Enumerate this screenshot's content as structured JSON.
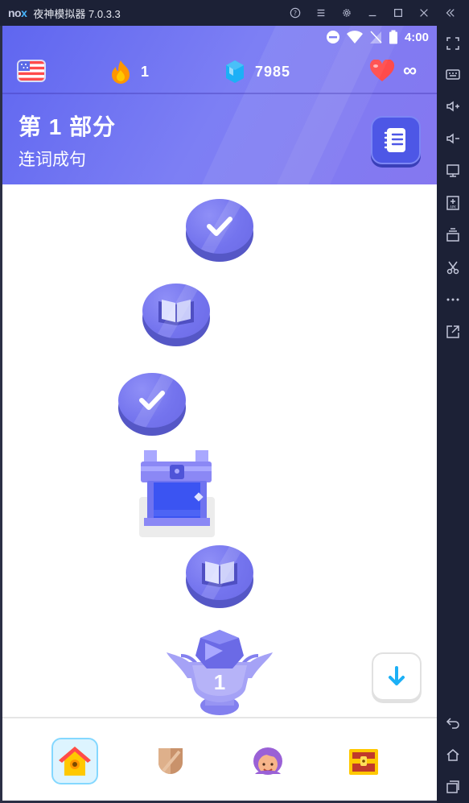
{
  "emulator": {
    "logo_a": "no",
    "logo_b": "x",
    "title": "夜神模拟器 7.0.3.3",
    "controls": [
      "help-icon",
      "menu-icon",
      "settings-icon",
      "minimize-icon",
      "maximize-icon",
      "close-icon",
      "collapse-icon"
    ],
    "sidebar_icons": [
      "fullscreen-icon",
      "keyboard-icon",
      "volume-up-icon",
      "volume-down-icon",
      "screen-icon",
      "apk-install-icon",
      "multi-instance-icon",
      "screenshot-cut-icon",
      "more-icon",
      "external-icon",
      "back-icon",
      "home-icon",
      "recent-apps-icon"
    ]
  },
  "status_bar": {
    "time": "4:00"
  },
  "topbar": {
    "streak_count": "1",
    "gems_count": "7985",
    "hearts_value": "∞"
  },
  "unit": {
    "title": "第 1 部分",
    "subtitle": "连词成句"
  },
  "path_nodes": [
    {
      "type": "completed-lesson",
      "icon": "check-icon"
    },
    {
      "type": "story",
      "icon": "book-icon"
    },
    {
      "type": "completed-lesson",
      "icon": "check-icon"
    },
    {
      "type": "chest",
      "icon": "chest-icon"
    },
    {
      "type": "story",
      "icon": "book-icon"
    },
    {
      "type": "trophy",
      "icon": "trophy-icon",
      "label": "1"
    }
  ],
  "bottom_nav": [
    "home-icon",
    "shield-league-icon",
    "profile-icon",
    "shop-chest-icon"
  ],
  "colors": {
    "header": "#7d7ff4",
    "node": "#7474ee",
    "node_dark": "#5557c6",
    "nav_active": "#ddf4ff",
    "streak": "#ff9600",
    "gem": "#1cb0f6",
    "heart": "#ff4b4b"
  }
}
